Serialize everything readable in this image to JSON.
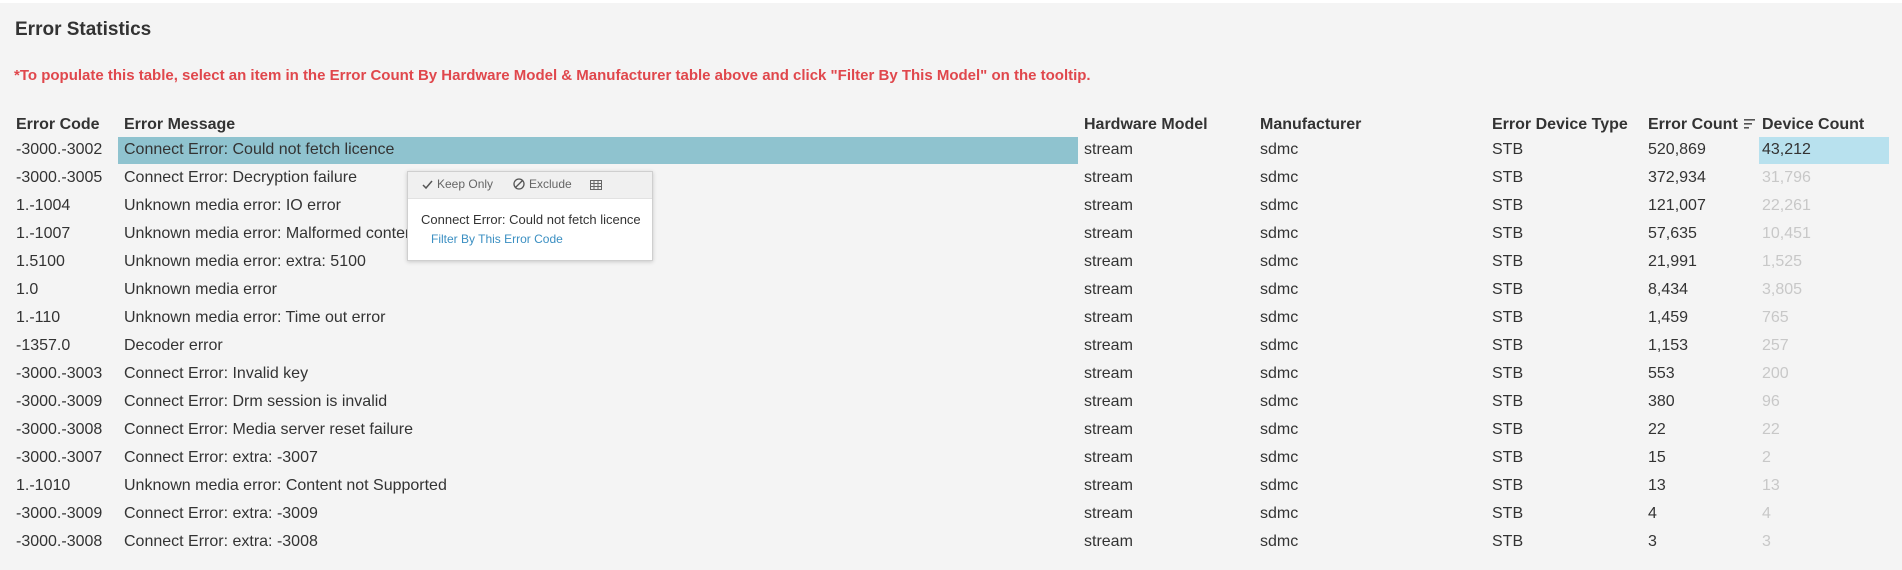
{
  "title": "Error Statistics",
  "note": "*To populate this table, select an item in the Error Count By Hardware Model & Manufacturer table above and click \"Filter By This Model\" on the tooltip.",
  "columns": {
    "code": "Error Code",
    "message": "Error Message",
    "hardware": "Hardware Model",
    "manufacturer": "Manufacturer",
    "device_type": "Error Device Type",
    "error_count": "Error Count",
    "device_count": "Device Count"
  },
  "rows": [
    {
      "code": "-3000.-3002",
      "message": "Connect Error: Could not fetch licence",
      "hardware": "stream",
      "manufacturer": "sdmc",
      "device_type": "STB",
      "error_count": "520,869",
      "device_count": "43,212"
    },
    {
      "code": "-3000.-3005",
      "message": "Connect Error: Decryption failure",
      "hardware": "stream",
      "manufacturer": "sdmc",
      "device_type": "STB",
      "error_count": "372,934",
      "device_count": "31,796"
    },
    {
      "code": "1.-1004",
      "message": "Unknown media error: IO error",
      "hardware": "stream",
      "manufacturer": "sdmc",
      "device_type": "STB",
      "error_count": "121,007",
      "device_count": "22,261"
    },
    {
      "code": "1.-1007",
      "message": "Unknown media error: Malformed conter",
      "hardware": "stream",
      "manufacturer": "sdmc",
      "device_type": "STB",
      "error_count": "57,635",
      "device_count": "10,451"
    },
    {
      "code": "1.5100",
      "message": "Unknown media error: extra: 5100",
      "hardware": "stream",
      "manufacturer": "sdmc",
      "device_type": "STB",
      "error_count": "21,991",
      "device_count": "1,525"
    },
    {
      "code": "1.0",
      "message": "Unknown media error",
      "hardware": "stream",
      "manufacturer": "sdmc",
      "device_type": "STB",
      "error_count": "8,434",
      "device_count": "3,805"
    },
    {
      "code": "1.-110",
      "message": "Unknown media error: Time out error",
      "hardware": "stream",
      "manufacturer": "sdmc",
      "device_type": "STB",
      "error_count": "1,459",
      "device_count": "765"
    },
    {
      "code": "-1357.0",
      "message": "Decoder error",
      "hardware": "stream",
      "manufacturer": "sdmc",
      "device_type": "STB",
      "error_count": "1,153",
      "device_count": "257"
    },
    {
      "code": "-3000.-3003",
      "message": "Connect Error: Invalid key",
      "hardware": "stream",
      "manufacturer": "sdmc",
      "device_type": "STB",
      "error_count": "553",
      "device_count": "200"
    },
    {
      "code": "-3000.-3009",
      "message": "Connect Error: Drm session is invalid",
      "hardware": "stream",
      "manufacturer": "sdmc",
      "device_type": "STB",
      "error_count": "380",
      "device_count": "96"
    },
    {
      "code": "-3000.-3008",
      "message": "Connect Error: Media server reset failure",
      "hardware": "stream",
      "manufacturer": "sdmc",
      "device_type": "STB",
      "error_count": "22",
      "device_count": "22"
    },
    {
      "code": "-3000.-3007",
      "message": "Connect Error: extra: -3007",
      "hardware": "stream",
      "manufacturer": "sdmc",
      "device_type": "STB",
      "error_count": "15",
      "device_count": "2"
    },
    {
      "code": "1.-1010",
      "message": "Unknown media error: Content not Supported",
      "hardware": "stream",
      "manufacturer": "sdmc",
      "device_type": "STB",
      "error_count": "13",
      "device_count": "13"
    },
    {
      "code": "-3000.-3009",
      "message": "Connect Error: extra: -3009",
      "hardware": "stream",
      "manufacturer": "sdmc",
      "device_type": "STB",
      "error_count": "4",
      "device_count": "4"
    },
    {
      "code": "-3000.-3008",
      "message": "Connect Error: extra: -3008",
      "hardware": "stream",
      "manufacturer": "sdmc",
      "device_type": "STB",
      "error_count": "3",
      "device_count": "3"
    }
  ],
  "selected_row": 0,
  "tooltip": {
    "keep_only_label": "Keep Only",
    "exclude_label": "Exclude",
    "keep_only_icon": "check-icon",
    "exclude_icon": "exclude-icon",
    "view_data_icon": "view-data-icon",
    "title": "Connect Error: Could not fetch licence",
    "link": "Filter By This Error Code"
  },
  "colors": {
    "note": "#e0474c",
    "selected_row": "#8fc3cf",
    "selected_device_cell": "#b8e1ee",
    "link": "#3b8fc2",
    "dimmed_text": "#c8c8c8"
  }
}
